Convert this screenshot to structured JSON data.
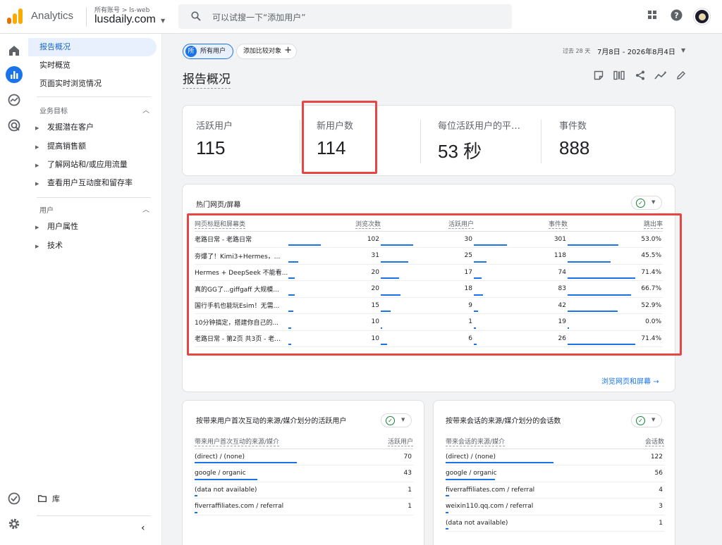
{
  "header": {
    "app_name": "Analytics",
    "account_crumb": "所有账号 > ls-web",
    "property_name": "lusdaily.com",
    "search_placeholder": "可以试搜一下“添加用户”",
    "colors": {
      "logo_orange": "#f9ab00",
      "logo_dark": "#e37400",
      "accent": "#1a73e8"
    }
  },
  "rail": {
    "items": [
      "home-icon",
      "reports-icon",
      "explore-icon",
      "advertising-icon"
    ],
    "bottom": [
      "admin-check-icon",
      "settings-icon"
    ]
  },
  "sidenav": {
    "items": [
      "报告概况",
      "实时概览",
      "页面实时浏览情况"
    ],
    "sections": [
      {
        "title": "业务目标",
        "items": [
          "发掘潜在客户",
          "提高销售额",
          "了解网站和/或应用流量",
          "查看用户互动度和留存率"
        ]
      },
      {
        "title": "用户",
        "items": [
          "用户属性",
          "技术"
        ]
      }
    ],
    "library": "库"
  },
  "toolbar": {
    "segment_badge": "所",
    "segment_label": "所有用户",
    "compare_label": "添加比较对象",
    "date_label": "过去 28 天",
    "date_range": "7月8日 - 2026年8月4日"
  },
  "page_title": "报告概况",
  "metrics": [
    {
      "label": "活跃用户",
      "value": "115"
    },
    {
      "label": "新用户数",
      "value": "114"
    },
    {
      "label": "每位活跃用户的平…",
      "value": "53 秒"
    },
    {
      "label": "事件数",
      "value": "888"
    }
  ],
  "top_pages": {
    "title": "热门网页/屏幕",
    "columns": [
      "网页标题和屏幕类",
      "浏览次数",
      "活跃用户",
      "事件数",
      "跳出率"
    ],
    "rows": [
      {
        "title": "老路日常 - 老路日常",
        "views": 102,
        "users": 30,
        "events": 301,
        "bounce": "53.0%"
      },
      {
        "title": "夯爆了！Kimi3+Hermes，...",
        "views": 31,
        "users": 25,
        "events": 118,
        "bounce": "45.5%"
      },
      {
        "title": "Hermes + DeepSeek 不能看...",
        "views": 20,
        "users": 17,
        "events": 74,
        "bounce": "71.4%"
      },
      {
        "title": "真的GG了...giffgaff 大规模...",
        "views": 20,
        "users": 18,
        "events": 83,
        "bounce": "66.7%"
      },
      {
        "title": "国行手机也能玩Esim！无需...",
        "views": 15,
        "users": 9,
        "events": 42,
        "bounce": "52.9%"
      },
      {
        "title": "10分钟搞定，搭建你自己的...",
        "views": 10,
        "users": 1,
        "events": 19,
        "bounce": "0.0%"
      },
      {
        "title": "老路日常 - 第2页 共3页 - 老...",
        "views": 10,
        "users": 6,
        "events": 26,
        "bounce": "71.4%"
      }
    ],
    "link": "浏览网页和屏幕"
  },
  "source_users": {
    "title": "按带来用户首次互动的来源/媒介划分的活跃用户",
    "columns": [
      "带来用户首次互动的来源/媒介",
      "活跃用户"
    ],
    "rows": [
      {
        "name": "(direct) / (none)",
        "value": 70
      },
      {
        "name": "google / organic",
        "value": 43
      },
      {
        "name": "(data not available)",
        "value": 1
      },
      {
        "name": "fiverraffiliates.com / referral",
        "value": 1
      }
    ]
  },
  "source_sessions": {
    "title": "按带来会话的来源/媒介划分的会话数",
    "columns": [
      "带来会话的来源/媒介",
      "会话数"
    ],
    "rows": [
      {
        "name": "(direct) / (none)",
        "value": 122
      },
      {
        "name": "google / organic",
        "value": 56
      },
      {
        "name": "fiverraffiliates.com / referral",
        "value": 4
      },
      {
        "name": "weixin110.qq.com / referral",
        "value": 3
      },
      {
        "name": "(data not available)",
        "value": 1
      }
    ]
  }
}
